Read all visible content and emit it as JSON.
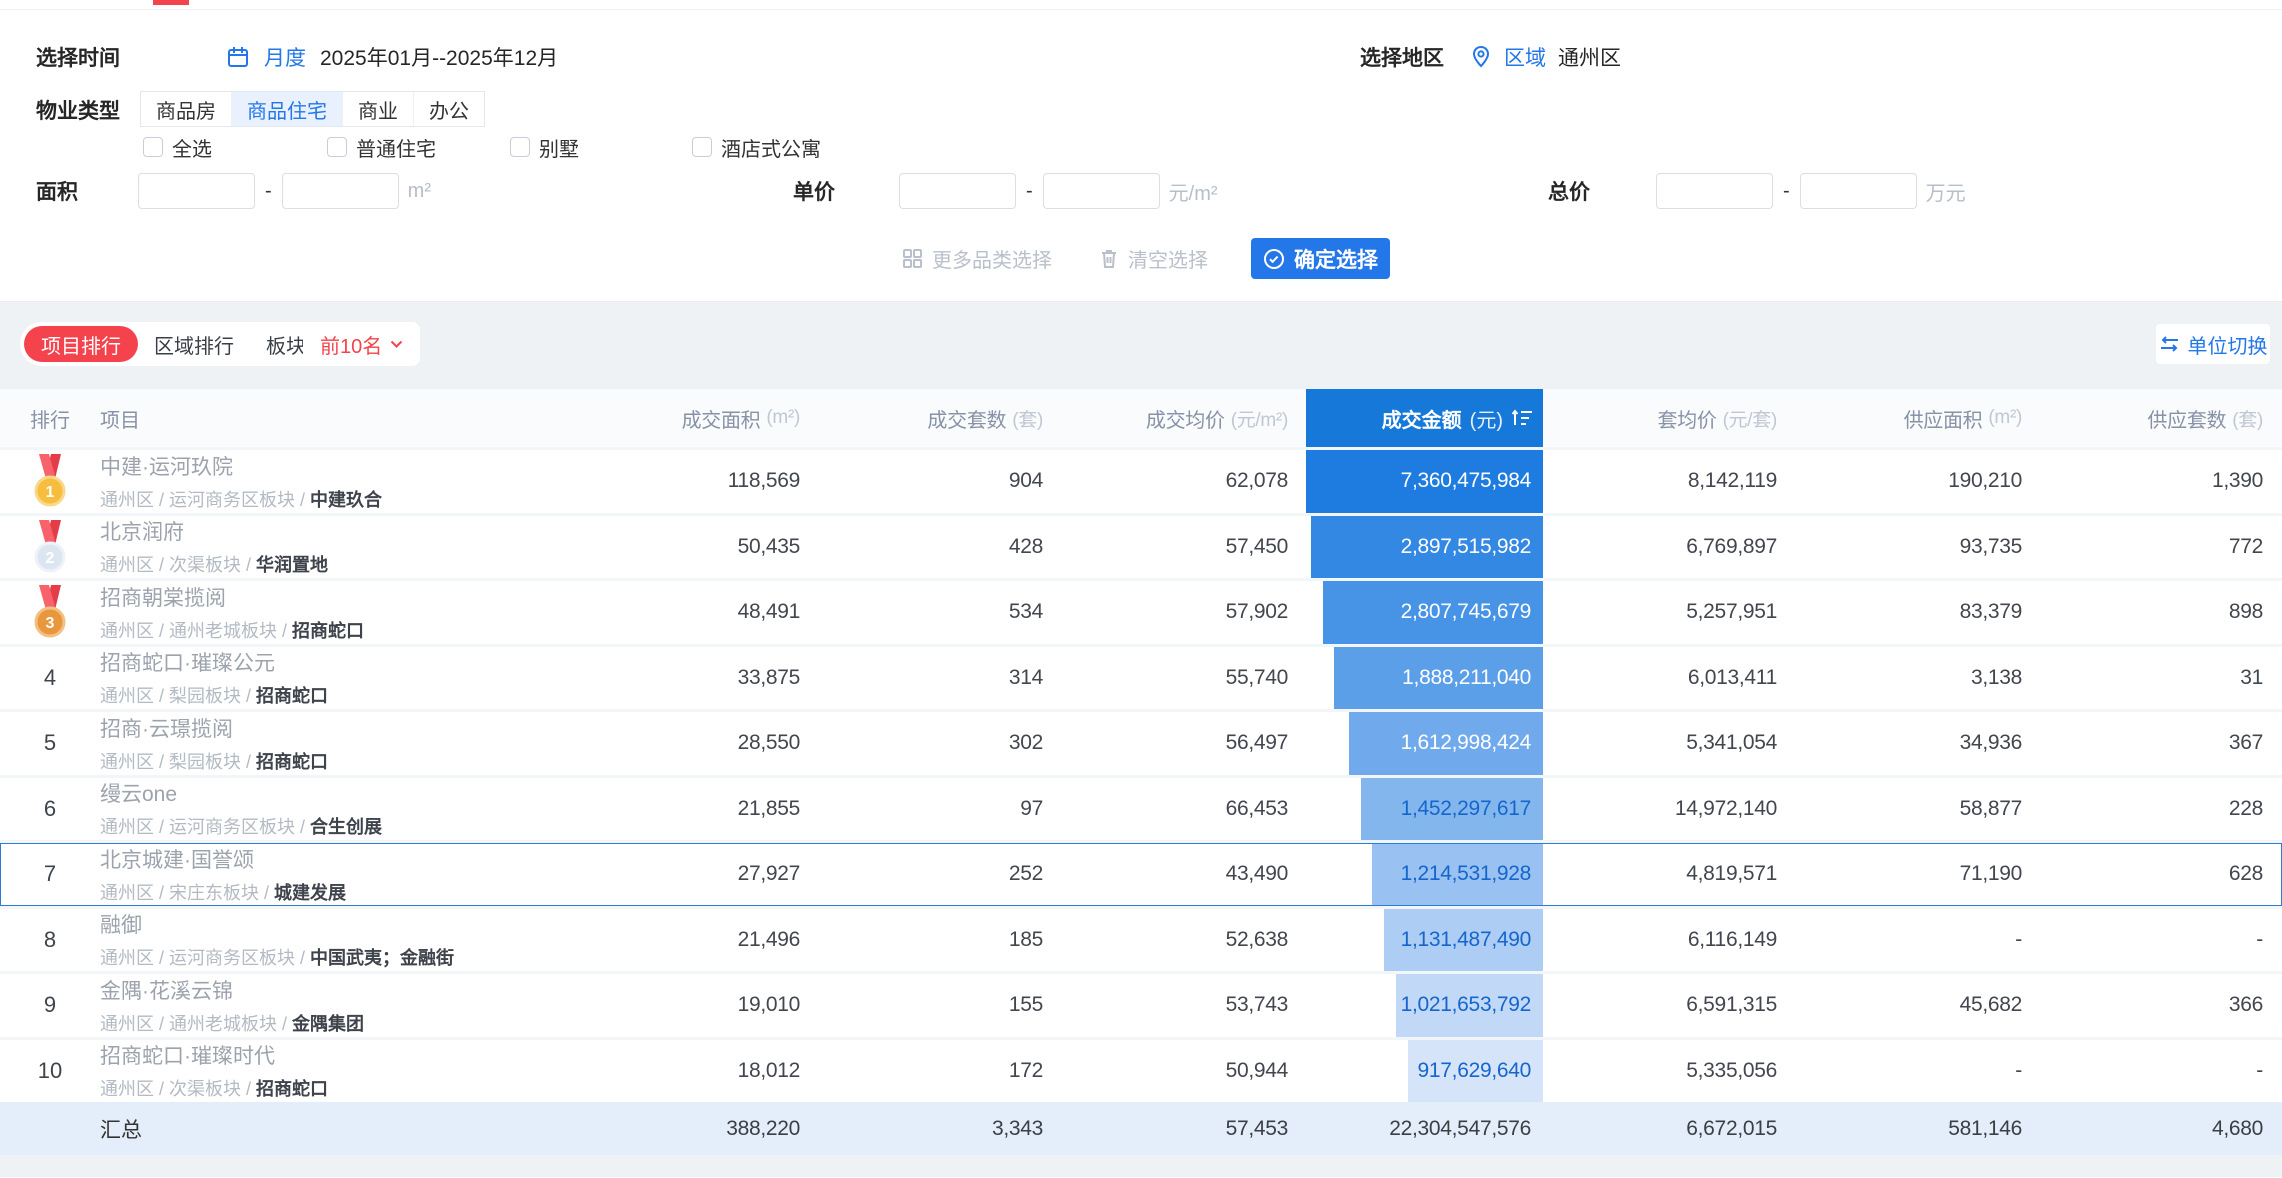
{
  "colors": {
    "primary_blue": "#2377E8",
    "money_header_blue": "#1678D9",
    "accent_red": "#F5434E",
    "bar_text_dark_rows": "#1566CC",
    "summary_bg": "#E4EEFB"
  },
  "filter": {
    "time_label": "选择时间",
    "time_mode": "月度",
    "time_range": "2025年01月--2025年12月",
    "region_label": "选择地区",
    "region_type": "区域",
    "region_value": "通州区",
    "ptype_label": "物业类型",
    "ptype_tabs": [
      "商品房",
      "商品住宅",
      "商业",
      "办公"
    ],
    "ptype_active": "商品住宅",
    "checkboxes": [
      "全选",
      "普通住宅",
      "别墅",
      "酒店式公寓"
    ],
    "area_label": "面积",
    "area_unit": "m²",
    "price_label": "单价",
    "price_unit": "元/m²",
    "total_label": "总价",
    "total_unit": "万元",
    "range_dash": "-",
    "more_btn": "更多品类选择",
    "clear_btn": "清空选择",
    "confirm_btn": "确定选择"
  },
  "rankbar": {
    "tabs": [
      "项目排行",
      "区域排行",
      "板块排行"
    ],
    "active_tab": "项目排行",
    "topn": "前10名",
    "unit_switch": "单位切换"
  },
  "table": {
    "headers": {
      "rank": "排行",
      "project": "项目",
      "deal_area": "成交面积",
      "deal_area_unit": "(m²)",
      "deal_units": "成交套数",
      "deal_units_unit": "(套)",
      "deal_avg": "成交均价",
      "deal_avg_unit": "(元/m²)",
      "deal_amount": "成交金额",
      "deal_amount_unit": "(元)",
      "unit_avg": "套均价",
      "unit_avg_unit": "(元/套)",
      "supply_area": "供应面积",
      "supply_area_unit": "(m²)",
      "supply_units": "供应套数",
      "supply_units_unit": "(套)"
    },
    "rows": [
      {
        "rank": 1,
        "medal": "gold",
        "name": "中建·运河玖院",
        "region_path": "通州区 / 运河商务区板块 / ",
        "developer": "中建玖合",
        "deal_area": "118,569",
        "deal_units": "904",
        "deal_avg": "62,078",
        "deal_amount": "7,360,475,984",
        "bar_pct": 100,
        "bar_color": "#1E7CE0",
        "bar_text": "#FFFFFF",
        "unit_avg": "8,142,119",
        "supply_area": "190,210",
        "supply_units": "1,390",
        "highlight": false
      },
      {
        "rank": 2,
        "medal": "silver",
        "name": "北京润府",
        "region_path": "通州区 / 次渠板块 / ",
        "developer": "华润置地",
        "deal_area": "50,435",
        "deal_units": "428",
        "deal_avg": "57,450",
        "deal_amount": "2,897,515,982",
        "bar_pct": 98,
        "bar_color": "#3288E3",
        "bar_text": "#FFFFFF",
        "unit_avg": "6,769,897",
        "supply_area": "93,735",
        "supply_units": "772",
        "highlight": false
      },
      {
        "rank": 3,
        "medal": "bronze",
        "name": "招商朝棠揽阅",
        "region_path": "通州区 / 通州老城板块 / ",
        "developer": "招商蛇口",
        "deal_area": "48,491",
        "deal_units": "534",
        "deal_avg": "57,902",
        "deal_amount": "2,807,745,679",
        "bar_pct": 93,
        "bar_color": "#4793E6",
        "bar_text": "#FFFFFF",
        "unit_avg": "5,257,951",
        "supply_area": "83,379",
        "supply_units": "898",
        "highlight": false
      },
      {
        "rank": 4,
        "medal": null,
        "name": "招商蛇口·璀璨公元",
        "region_path": "通州区 / 梨园板块 / ",
        "developer": "招商蛇口",
        "deal_area": "33,875",
        "deal_units": "314",
        "deal_avg": "55,740",
        "deal_amount": "1,888,211,040",
        "bar_pct": 88,
        "bar_color": "#5B9FE9",
        "bar_text": "#FFFFFF",
        "unit_avg": "6,013,411",
        "supply_area": "3,138",
        "supply_units": "31",
        "highlight": false
      },
      {
        "rank": 5,
        "medal": null,
        "name": "招商·云璟揽阅",
        "region_path": "通州区 / 梨园板块 / ",
        "developer": "招商蛇口",
        "deal_area": "28,550",
        "deal_units": "302",
        "deal_avg": "56,497",
        "deal_amount": "1,612,998,424",
        "bar_pct": 82,
        "bar_color": "#70AAEC",
        "bar_text": "#FFFFFF",
        "unit_avg": "5,341,054",
        "supply_area": "34,936",
        "supply_units": "367",
        "highlight": false
      },
      {
        "rank": 6,
        "medal": null,
        "name": "缦云one",
        "region_path": "通州区 / 运河商务区板块 / ",
        "developer": "合生创展",
        "deal_area": "21,855",
        "deal_units": "97",
        "deal_avg": "66,453",
        "deal_amount": "1,452,297,617",
        "bar_pct": 77,
        "bar_color": "#84B6EE",
        "bar_text": "#1566CC",
        "unit_avg": "14,972,140",
        "supply_area": "58,877",
        "supply_units": "228",
        "highlight": false
      },
      {
        "rank": 7,
        "medal": null,
        "name": "北京城建·国誉颂",
        "region_path": "通州区 / 宋庄东板块 / ",
        "developer": "城建发展",
        "deal_area": "27,927",
        "deal_units": "252",
        "deal_avg": "43,490",
        "deal_amount": "1,214,531,928",
        "bar_pct": 72,
        "bar_color": "#99C1F1",
        "bar_text": "#1566CC",
        "unit_avg": "4,819,571",
        "supply_area": "71,190",
        "supply_units": "628",
        "highlight": true
      },
      {
        "rank": 8,
        "medal": null,
        "name": "融御",
        "region_path": "通州区 / 运河商务区板块 / ",
        "developer": "中国武夷；金融街",
        "deal_area": "21,496",
        "deal_units": "185",
        "deal_avg": "52,638",
        "deal_amount": "1,131,487,490",
        "bar_pct": 67,
        "bar_color": "#ADCDF4",
        "bar_text": "#1566CC",
        "unit_avg": "6,116,149",
        "supply_area": "-",
        "supply_units": "-",
        "highlight": false
      },
      {
        "rank": 9,
        "medal": null,
        "name": "金隅·花溪云锦",
        "region_path": "通州区 / 通州老城板块 / ",
        "developer": "金隅集团",
        "deal_area": "19,010",
        "deal_units": "155",
        "deal_avg": "53,743",
        "deal_amount": "1,021,653,792",
        "bar_pct": 62,
        "bar_color": "#C2D8F7",
        "bar_text": "#1566CC",
        "unit_avg": "6,591,315",
        "supply_area": "45,682",
        "supply_units": "366",
        "highlight": false
      },
      {
        "rank": 10,
        "medal": null,
        "name": "招商蛇口·璀璨时代",
        "region_path": "通州区 / 次渠板块 / ",
        "developer": "招商蛇口",
        "deal_area": "18,012",
        "deal_units": "172",
        "deal_avg": "50,944",
        "deal_amount": "917,629,640",
        "bar_pct": 57,
        "bar_color": "#D6E4FA",
        "bar_text": "#1566CC",
        "unit_avg": "5,335,056",
        "supply_area": "-",
        "supply_units": "-",
        "highlight": false
      }
    ],
    "summary": {
      "label": "汇总",
      "deal_area": "388,220",
      "deal_units": "3,343",
      "deal_avg": "57,453",
      "deal_amount": "22,304,547,576",
      "unit_avg": "6,672,015",
      "supply_area": "581,146",
      "supply_units": "4,680"
    }
  }
}
